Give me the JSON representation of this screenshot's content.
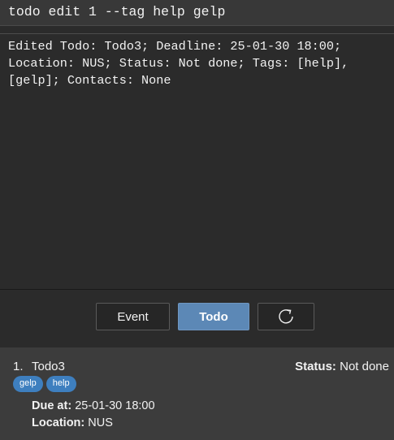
{
  "command_box": {
    "value": "todo edit 1 --tag help gelp"
  },
  "result_display": {
    "text": "Edited Todo: Todo3; Deadline: 25-01-30 18:00; Location: NUS; Status: Not done; Tags: [help], [gelp]; Contacts: None"
  },
  "mode_bar": {
    "event_label": "Event",
    "todo_label": "Todo",
    "refresh_icon": "refresh-icon",
    "active_mode": "Todo"
  },
  "todo_list": {
    "items": [
      {
        "index": "1.",
        "name": "Todo3",
        "status_label": "Status:",
        "status_value": "Not done",
        "tags": [
          "gelp",
          "help"
        ],
        "due_label": "Due at:",
        "due_value": "25-01-30 18:00",
        "location_label": "Location:",
        "location_value": "NUS"
      }
    ]
  },
  "colors": {
    "background": "#2b2b2b",
    "command_bg": "#383838",
    "active_button": "#5c88b6",
    "tag_bg": "#3e7fbf",
    "list_bg": "#3c3c3c"
  }
}
